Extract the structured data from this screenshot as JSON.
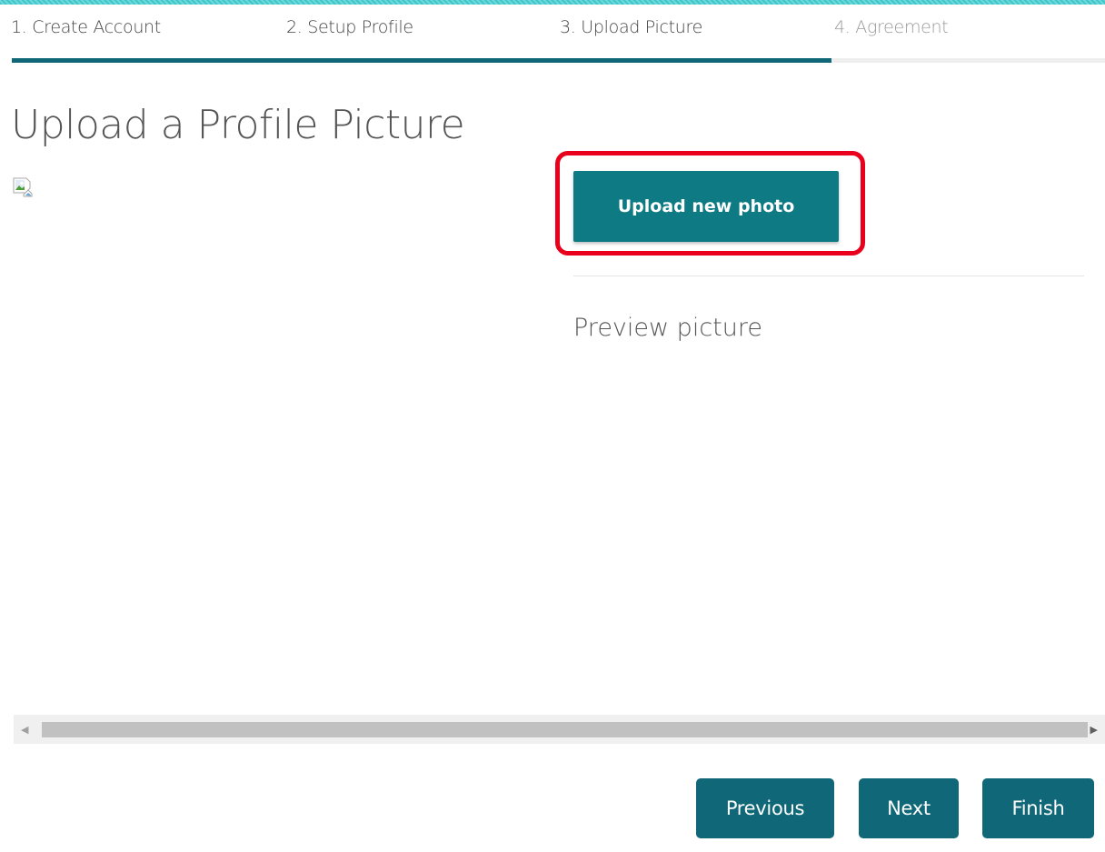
{
  "wizard": {
    "steps": [
      {
        "label": "1. Create Account",
        "state": "done"
      },
      {
        "label": "2. Setup Profile",
        "state": "done"
      },
      {
        "label": "3. Upload Picture",
        "state": "current"
      },
      {
        "label": "4. Agreement",
        "state": "pending"
      }
    ],
    "progress_fraction": 0.75,
    "accent_color": "#0f6777"
  },
  "main": {
    "title": "Upload a Profile Picture",
    "image_icon": "broken-image-icon",
    "upload_button_label": "Upload new photo",
    "preview_label": "Preview picture",
    "highlight_color": "#e8001c"
  },
  "scrollbar": {
    "left_arrow": "◀",
    "right_arrow": "▶"
  },
  "footer": {
    "previous_label": "Previous",
    "next_label": "Next",
    "finish_label": "Finish"
  }
}
